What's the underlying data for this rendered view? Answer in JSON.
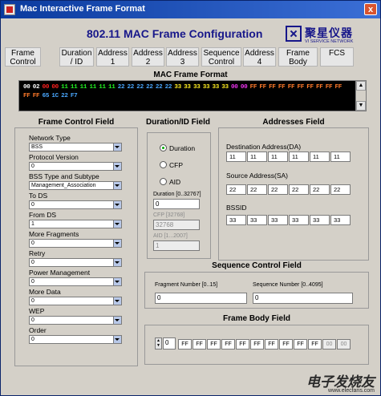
{
  "window": {
    "title": "Mac Interactive Frame Format",
    "close_glyph": "x"
  },
  "header": {
    "title": "802.11 MAC Frame Configuration",
    "logo_cn": "聚星仪器",
    "logo_en": "VI SERVICE NETWORK"
  },
  "frame_fields": [
    "Frame Control",
    "Duration / ID",
    "Address 1",
    "Address 2",
    "Address 3",
    "Sequence Control",
    "Address 4",
    "Frame Body",
    "FCS"
  ],
  "mac_frame_format": {
    "label": "MAC Frame Format",
    "segments": [
      {
        "text": "00 02",
        "color": "#ffffff"
      },
      {
        "text": "00 00",
        "color": "#ff2020"
      },
      {
        "text": "11 11 11 11 11 11",
        "color": "#22ee22"
      },
      {
        "text": "22 22 22 22 22 22",
        "color": "#4aa8ff"
      },
      {
        "text": "33 33 33 33 33 33",
        "color": "#ffee22"
      },
      {
        "text": "00 00",
        "color": "#ee33ee"
      },
      {
        "text": "FF FF FF FF FF FF FF FF FF FF FF FF",
        "color": "#ff7a2a"
      },
      {
        "text": "65 1C 22 F7",
        "color": "#4aa8ff"
      }
    ]
  },
  "frame_control": {
    "title": "Frame Control Field",
    "fields": [
      {
        "label": "Network Type",
        "value": "BSS"
      },
      {
        "label": "Protocol Version",
        "value": "0"
      },
      {
        "label": "BSS Type and Subtype",
        "value": "Management_Association"
      },
      {
        "label": "To DS",
        "value": "0"
      },
      {
        "label": "From DS",
        "value": "1"
      },
      {
        "label": "More Fragments",
        "value": "0"
      },
      {
        "label": "Retry",
        "value": "0"
      },
      {
        "label": "Power Management",
        "value": "0"
      },
      {
        "label": "More Data",
        "value": "0"
      },
      {
        "label": "WEP",
        "value": "0"
      },
      {
        "label": "Order",
        "value": "0"
      }
    ]
  },
  "duration_id": {
    "title": "Duration/ID Field",
    "options": [
      "Duration",
      "CFP",
      "AID"
    ],
    "selected": "Duration",
    "duration_label": "Duration [0..32767]",
    "duration_value": "0",
    "cfp_label": "CFP [32768]",
    "cfp_value": "32768",
    "aid_label": "AID [1...2007]",
    "aid_value": "1"
  },
  "addresses": {
    "title": "Addresses Field",
    "dest_label": "Destination Address(DA)",
    "dest": [
      "11",
      "11",
      "11",
      "11",
      "11",
      "11"
    ],
    "source_label": "Source Address(SA)",
    "source": [
      "22",
      "22",
      "22",
      "22",
      "22",
      "22"
    ],
    "bssid_label": "BSSID",
    "bssid": [
      "33",
      "33",
      "33",
      "33",
      "33",
      "33"
    ]
  },
  "sequence_control": {
    "title": "Sequence Control Field",
    "fragment_label": "Fragment Number [0..15]",
    "fragment_value": "0",
    "sequence_label": "Sequence Number [0..4095]",
    "sequence_value": "0"
  },
  "frame_body": {
    "title": "Frame Body Field",
    "index_value": "0",
    "bytes": [
      "FF",
      "FF",
      "FF",
      "FF",
      "FF",
      "FF",
      "FF",
      "FF",
      "FF",
      "FF",
      "FF",
      "FF"
    ],
    "disabled_bytes": [
      "00",
      "00"
    ]
  },
  "watermark": {
    "main": "电子发烧友",
    "sub": "www.elecfans.com"
  }
}
